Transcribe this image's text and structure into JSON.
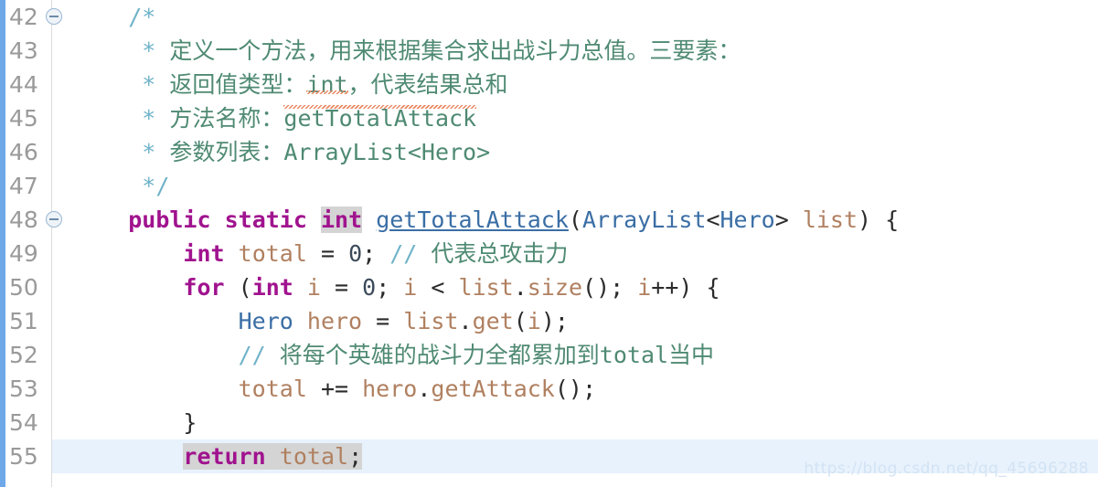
{
  "editor": {
    "watermark": "https://blog.csdn.net/qq_45696288",
    "colors": {
      "keyword": "#a0138e",
      "comment": "#4f8a73",
      "comment_delimiter": "#6fb3c9",
      "type": "#3a6ea5",
      "identifier": "#b08060",
      "background": "#ffffff",
      "current_line": "#e8f2fd",
      "occurrence_highlight": "#d4d4d4",
      "change_bar": "#6fa8e8",
      "line_number": "#9a9a9a",
      "watermark": "#d2e3f4"
    },
    "lines": [
      {
        "number": "42",
        "fold": true,
        "current": false,
        "tokens": [
          {
            "text": "    ",
            "cls": "plain"
          },
          {
            "text": "/*",
            "cls": "cmtmk"
          }
        ]
      },
      {
        "number": "43",
        "fold": false,
        "current": false,
        "tokens": [
          {
            "text": "     ",
            "cls": "plain"
          },
          {
            "text": "*",
            "cls": "cmtmk"
          },
          {
            "text": " 定义一个方法，用来根据集合求出战斗力总值。三要素：",
            "cls": "cmt"
          }
        ]
      },
      {
        "number": "44",
        "fold": false,
        "current": false,
        "tokens": [
          {
            "text": "     ",
            "cls": "plain"
          },
          {
            "text": "*",
            "cls": "cmtmk"
          },
          {
            "text": " 返回值类型：",
            "cls": "cmt"
          },
          {
            "text": "int",
            "cls": "cmt squig"
          },
          {
            "text": "，代表结果总和",
            "cls": "cmt"
          }
        ]
      },
      {
        "number": "45",
        "fold": false,
        "current": false,
        "tokens": [
          {
            "text": "     ",
            "cls": "plain"
          },
          {
            "text": "*",
            "cls": "cmtmk"
          },
          {
            "text": " 方法名称：",
            "cls": "cmt"
          },
          {
            "text": "getTotalAttack",
            "cls": "cmt squig squig-top"
          }
        ]
      },
      {
        "number": "46",
        "fold": false,
        "current": false,
        "tokens": [
          {
            "text": "     ",
            "cls": "plain"
          },
          {
            "text": "*",
            "cls": "cmtmk"
          },
          {
            "text": " 参数列表：",
            "cls": "cmt"
          },
          {
            "text": "ArrayList<Hero>",
            "cls": "cmt"
          }
        ]
      },
      {
        "number": "47",
        "fold": false,
        "current": false,
        "tokens": [
          {
            "text": "     ",
            "cls": "plain"
          },
          {
            "text": "*",
            "cls": "cmtmk"
          },
          {
            "text": "/",
            "cls": "cmtmk"
          }
        ]
      },
      {
        "number": "48",
        "fold": true,
        "current": false,
        "tokens": [
          {
            "text": "    ",
            "cls": "plain"
          },
          {
            "text": "public",
            "cls": "kw"
          },
          {
            "text": " ",
            "cls": "plain"
          },
          {
            "text": "static",
            "cls": "kw"
          },
          {
            "text": " ",
            "cls": "plain"
          },
          {
            "text": "int",
            "cls": "kw occ"
          },
          {
            "text": " ",
            "cls": "plain"
          },
          {
            "text": "getTotalAttack",
            "cls": "mname"
          },
          {
            "text": "(",
            "cls": "plain"
          },
          {
            "text": "ArrayList",
            "cls": "type"
          },
          {
            "text": "<",
            "cls": "plain"
          },
          {
            "text": "Hero",
            "cls": "type"
          },
          {
            "text": "> ",
            "cls": "plain"
          },
          {
            "text": "list",
            "cls": "param"
          },
          {
            "text": ") {",
            "cls": "plain"
          }
        ]
      },
      {
        "number": "49",
        "fold": false,
        "current": false,
        "tokens": [
          {
            "text": "        ",
            "cls": "plain"
          },
          {
            "text": "int",
            "cls": "kw"
          },
          {
            "text": " ",
            "cls": "plain"
          },
          {
            "text": "total",
            "cls": "id"
          },
          {
            "text": " = ",
            "cls": "plain"
          },
          {
            "text": "0",
            "cls": "num"
          },
          {
            "text": "; ",
            "cls": "plain"
          },
          {
            "text": "//",
            "cls": "cmtmk"
          },
          {
            "text": " 代表总攻击力",
            "cls": "cmt"
          }
        ]
      },
      {
        "number": "50",
        "fold": false,
        "current": false,
        "tokens": [
          {
            "text": "        ",
            "cls": "plain"
          },
          {
            "text": "for",
            "cls": "kw"
          },
          {
            "text": " (",
            "cls": "plain"
          },
          {
            "text": "int",
            "cls": "kw"
          },
          {
            "text": " ",
            "cls": "plain"
          },
          {
            "text": "i",
            "cls": "id"
          },
          {
            "text": " = ",
            "cls": "plain"
          },
          {
            "text": "0",
            "cls": "num"
          },
          {
            "text": "; ",
            "cls": "plain"
          },
          {
            "text": "i",
            "cls": "id"
          },
          {
            "text": " < ",
            "cls": "plain"
          },
          {
            "text": "list",
            "cls": "id"
          },
          {
            "text": ".",
            "cls": "plain"
          },
          {
            "text": "size",
            "cls": "id"
          },
          {
            "text": "(); ",
            "cls": "plain"
          },
          {
            "text": "i",
            "cls": "id"
          },
          {
            "text": "++) {",
            "cls": "plain"
          }
        ]
      },
      {
        "number": "51",
        "fold": false,
        "current": false,
        "tokens": [
          {
            "text": "            ",
            "cls": "plain"
          },
          {
            "text": "Hero",
            "cls": "type"
          },
          {
            "text": " ",
            "cls": "plain"
          },
          {
            "text": "hero",
            "cls": "id"
          },
          {
            "text": " = ",
            "cls": "plain"
          },
          {
            "text": "list",
            "cls": "id"
          },
          {
            "text": ".",
            "cls": "plain"
          },
          {
            "text": "get",
            "cls": "id"
          },
          {
            "text": "(",
            "cls": "plain"
          },
          {
            "text": "i",
            "cls": "id"
          },
          {
            "text": ");",
            "cls": "plain"
          }
        ]
      },
      {
        "number": "52",
        "fold": false,
        "current": false,
        "tokens": [
          {
            "text": "            ",
            "cls": "plain"
          },
          {
            "text": "//",
            "cls": "cmtmk"
          },
          {
            "text": " 将每个英雄的战斗力全都累加到total当中",
            "cls": "cmt"
          }
        ]
      },
      {
        "number": "53",
        "fold": false,
        "current": false,
        "tokens": [
          {
            "text": "            ",
            "cls": "plain"
          },
          {
            "text": "total",
            "cls": "id"
          },
          {
            "text": " += ",
            "cls": "plain"
          },
          {
            "text": "hero",
            "cls": "id"
          },
          {
            "text": ".",
            "cls": "plain"
          },
          {
            "text": "getAttack",
            "cls": "id"
          },
          {
            "text": "();",
            "cls": "plain"
          }
        ]
      },
      {
        "number": "54",
        "fold": false,
        "current": false,
        "tokens": [
          {
            "text": "        }",
            "cls": "plain"
          }
        ]
      },
      {
        "number": "55",
        "fold": false,
        "current": true,
        "tokens": [
          {
            "text": "        ",
            "cls": "plain"
          },
          {
            "text": "return",
            "cls": "kw sel"
          },
          {
            "text": " ",
            "cls": "plain sel"
          },
          {
            "text": "total",
            "cls": "id sel"
          },
          {
            "text": ";",
            "cls": "plain sel"
          }
        ]
      }
    ]
  }
}
